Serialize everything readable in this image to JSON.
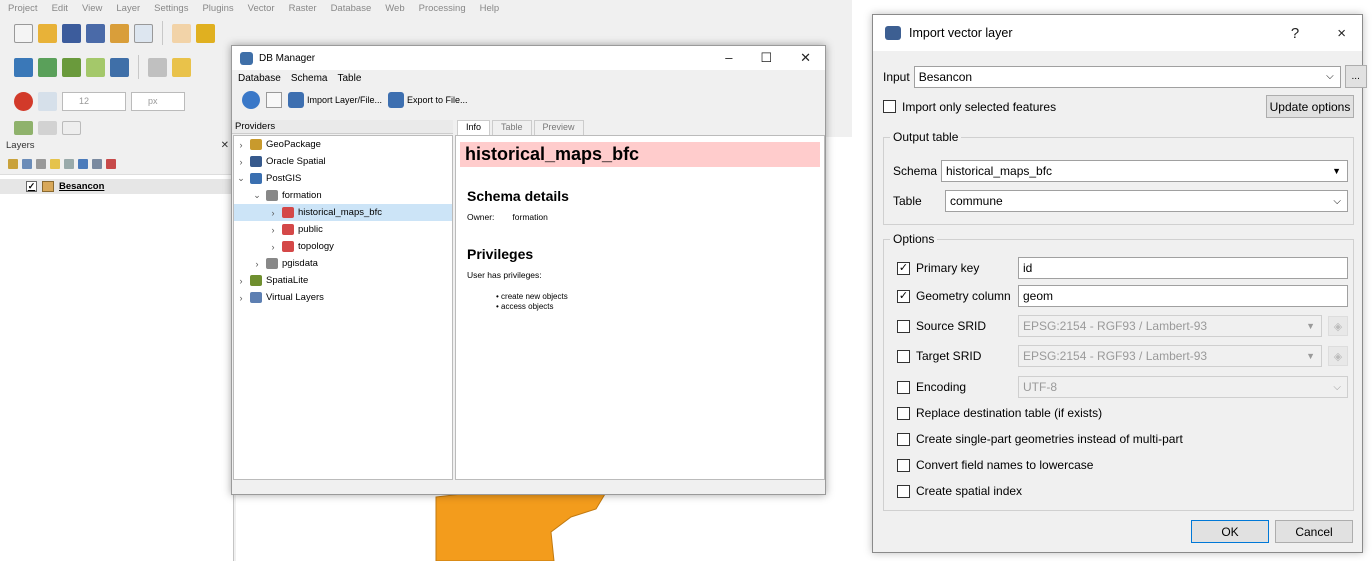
{
  "qgis": {
    "menu": [
      "Project",
      "Edit",
      "View",
      "Layer",
      "Settings",
      "Plugins",
      "Vector",
      "Raster",
      "Database",
      "Web",
      "Processing",
      "Help"
    ],
    "font_size": "12",
    "font_unit": "px",
    "layers_title": "Layers",
    "layer_name": "Besancon"
  },
  "db_manager": {
    "title": "DB Manager",
    "menu": [
      "Database",
      "Schema",
      "Table"
    ],
    "import_label": "Import Layer/File...",
    "export_label": "Export to File...",
    "providers_header": "Providers",
    "tree": [
      {
        "label": "GeoPackage",
        "arrow": "›",
        "indent": 0,
        "icon": "geopackage-icon",
        "color": "#c89a2d"
      },
      {
        "label": "Oracle Spatial",
        "arrow": "›",
        "indent": 0,
        "icon": "oracle-icon",
        "color": "#36598c"
      },
      {
        "label": "PostGIS",
        "arrow": "⌄",
        "indent": 0,
        "icon": "postgis-icon",
        "color": "#3a6fb0"
      },
      {
        "label": "formation",
        "arrow": "⌄",
        "indent": 1,
        "icon": "database-icon",
        "color": "#888888"
      },
      {
        "label": "historical_maps_bfc",
        "arrow": "›",
        "indent": 2,
        "icon": "schema-icon",
        "color": "#d44848",
        "selected": true
      },
      {
        "label": "public",
        "arrow": "›",
        "indent": 2,
        "icon": "schema-icon",
        "color": "#d44848"
      },
      {
        "label": "topology",
        "arrow": "›",
        "indent": 2,
        "icon": "schema-icon",
        "color": "#d44848"
      },
      {
        "label": "pgisdata",
        "arrow": "›",
        "indent": 1,
        "icon": "database-icon",
        "color": "#888888"
      },
      {
        "label": "SpatiaLite",
        "arrow": "›",
        "indent": 0,
        "icon": "spatialite-icon",
        "color": "#6f8f2f"
      },
      {
        "label": "Virtual Layers",
        "arrow": "›",
        "indent": 0,
        "icon": "virtual-layers-icon",
        "color": "#5d7fb2"
      }
    ],
    "tabs": [
      "Info",
      "Table",
      "Preview"
    ],
    "info_title": "historical_maps_bfc",
    "schema_details": "Schema details",
    "owner_label": "Owner:",
    "owner_value": "formation",
    "privileges": "Privileges",
    "privileges_text": "User has privileges:",
    "privilege_items": [
      "• create new objects",
      "• access objects"
    ]
  },
  "dialog": {
    "title": "Import vector layer",
    "help": "?",
    "close": "×",
    "input_label": "Input",
    "input_value": "Besancon",
    "more": "...",
    "import_selected": "Import only selected features",
    "update_options": "Update options",
    "output_table": "Output table",
    "schema_label": "Schema",
    "schema_value": "historical_maps_bfc",
    "table_label": "Table",
    "table_value": "commune",
    "options": "Options",
    "primary_key_label": "Primary key",
    "primary_key_value": "id",
    "geometry_label": "Geometry column",
    "geometry_value": "geom",
    "source_srid_label": "Source SRID",
    "source_srid_value": "EPSG:2154 - RGF93 / Lambert-93",
    "target_srid_label": "Target SRID",
    "target_srid_value": "EPSG:2154 - RGF93 / Lambert-93",
    "encoding_label": "Encoding",
    "encoding_value": "UTF-8",
    "replace": "Replace destination table (if exists)",
    "single_part": "Create single-part geometries instead of multi-part",
    "lowercase": "Convert field names to lowercase",
    "spatial_index": "Create spatial index",
    "ok": "OK",
    "cancel": "Cancel",
    "check_mark": "✓"
  }
}
